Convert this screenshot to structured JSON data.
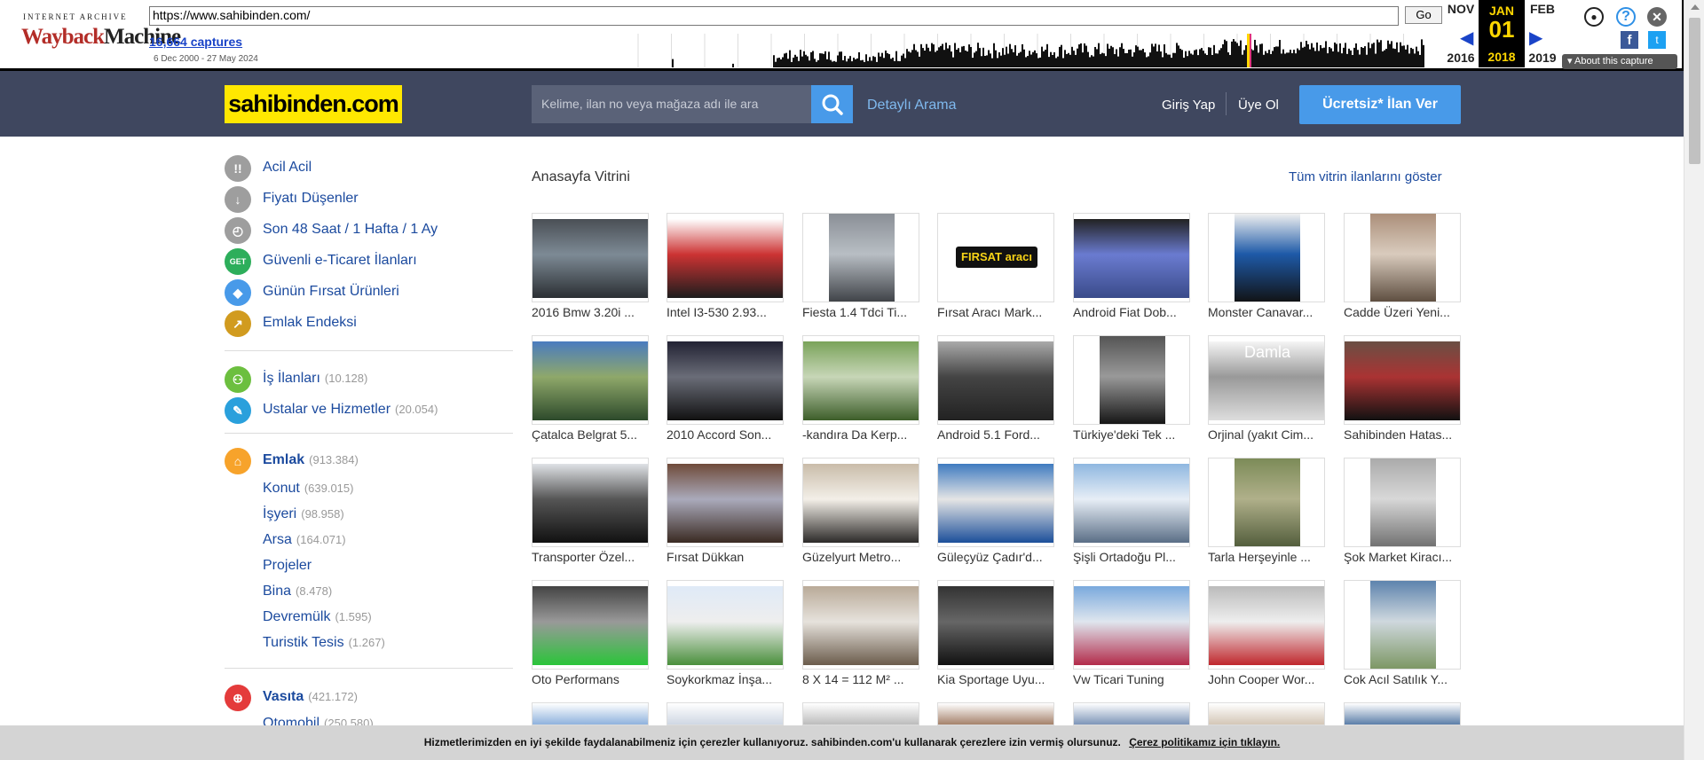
{
  "wayback": {
    "logo_top": "INTERNET ARCHIVE",
    "logo_main_a": "Wayback",
    "logo_main_b": "Machine",
    "url": "https://www.sahibinden.com/",
    "go_label": "Go",
    "captures": "16,664 captures",
    "range": "6 Dec 2000 - 27 May 2024",
    "prev_month": "NOV",
    "prev_year": "2016",
    "cur_month": "JAN",
    "cur_day": "01",
    "cur_year": "2018",
    "next_month": "FEB",
    "next_year": "2019",
    "about": "About this capture",
    "icons": [
      "user-icon",
      "help-icon",
      "close-icon",
      "facebook-icon",
      "twitter-icon"
    ]
  },
  "header": {
    "logo": "sahibinden.com",
    "search_placeholder": "Kelime, ilan no veya mağaza adı ile ara",
    "advanced_search": "Detaylı Arama",
    "login": "Giriş Yap",
    "signup": "Üye Ol",
    "post_button": "Ücretsiz* İlan Ver",
    "brand_color": "#ffe800",
    "accent_color": "#489ae9"
  },
  "sidebar": {
    "quick": [
      {
        "label": "Acil Acil",
        "icon": "!!",
        "color": "#9e9e9e"
      },
      {
        "label": "Fiyatı Düşenler",
        "icon": "↓",
        "color": "#9e9e9e"
      },
      {
        "label": "Son 48 Saat / 1 Hafta / 1 Ay",
        "icon": "◴",
        "color": "#9e9e9e"
      },
      {
        "label": "Güvenli e-Ticaret İlanları",
        "icon": "GET",
        "color": "#2dae5b"
      },
      {
        "label": "Günün Fırsat Ürünleri",
        "icon": "◆",
        "color": "#489ae9"
      },
      {
        "label": "Emlak Endeksi",
        "icon": "↗",
        "color": "#d19b1f"
      }
    ],
    "jobs": [
      {
        "label": "İş İlanları",
        "count": "(10.128)",
        "color": "#6cbf3f"
      },
      {
        "label": "Ustalar ve Hizmetler",
        "count": "(20.054)",
        "color": "#2aa0dc"
      }
    ],
    "emlak": {
      "label": "Emlak",
      "count": "(913.384)",
      "color": "#f7a32b",
      "subs": [
        {
          "label": "Konut",
          "count": "(639.015)"
        },
        {
          "label": "İşyeri",
          "count": "(98.958)"
        },
        {
          "label": "Arsa",
          "count": "(164.071)"
        },
        {
          "label": "Projeler",
          "count": ""
        },
        {
          "label": "Bina",
          "count": "(8.478)"
        },
        {
          "label": "Devremülk",
          "count": "(1.595)"
        },
        {
          "label": "Turistik Tesis",
          "count": "(1.267)"
        }
      ]
    },
    "vasita": {
      "label": "Vasıta",
      "count": "(421.172)",
      "color": "#e43b3b",
      "subs": [
        {
          "label": "Otomobil",
          "count": "(250.580)"
        }
      ]
    }
  },
  "main": {
    "title": "Anasayfa Vitrini",
    "all_link": "Tüm vitrin ilanlarını göster",
    "items": [
      "2016 Bmw 3.20i ...",
      "Intel I3-530 2.93...",
      "Fiesta 1.4 Tdci Ti...",
      "Fırsat Aracı Mark...",
      "Android Fiat Dob...",
      "Monster Canavar...",
      "Cadde Üzeri Yeni...",
      "Çatalca Belgrat 5...",
      "2010 Accord Son...",
      "-kandıra Da Kerp...",
      "Android 5.1 Ford...",
      "Türkiye'deki Tek ...",
      "Orjinal (yakıt Cim...",
      "Sahibinden Hatas...",
      "Transporter Özel...",
      "Fırsat Dükkan",
      "Güzelyurt Metro...",
      "Güleçyüz Çadır'd...",
      "Şişli Ortadoğu Pl...",
      "Tarla Herşeyinle ...",
      "Şok Market Kiracı...",
      "Oto Performans",
      "Soykorkmaz İnşa...",
      "8 X 14 = 112 M² ...",
      "Kia Sportage Uyu...",
      "Vw Ticari Tuning",
      "John Cooper Wor...",
      "Cok Acıl Satılık Y..."
    ],
    "thumb_text": {
      "firsat": "FIRSAT aracı",
      "damla": "Damla"
    }
  },
  "cookie": {
    "text": "Hizmetlerimizden en iyi şekilde faydalanabilmeniz için çerezler kullanıyoruz. sahibinden.com'u kullanarak çerezlere izin vermiş olursunuz.",
    "link": "Çerez politikamız için tıklayın."
  }
}
